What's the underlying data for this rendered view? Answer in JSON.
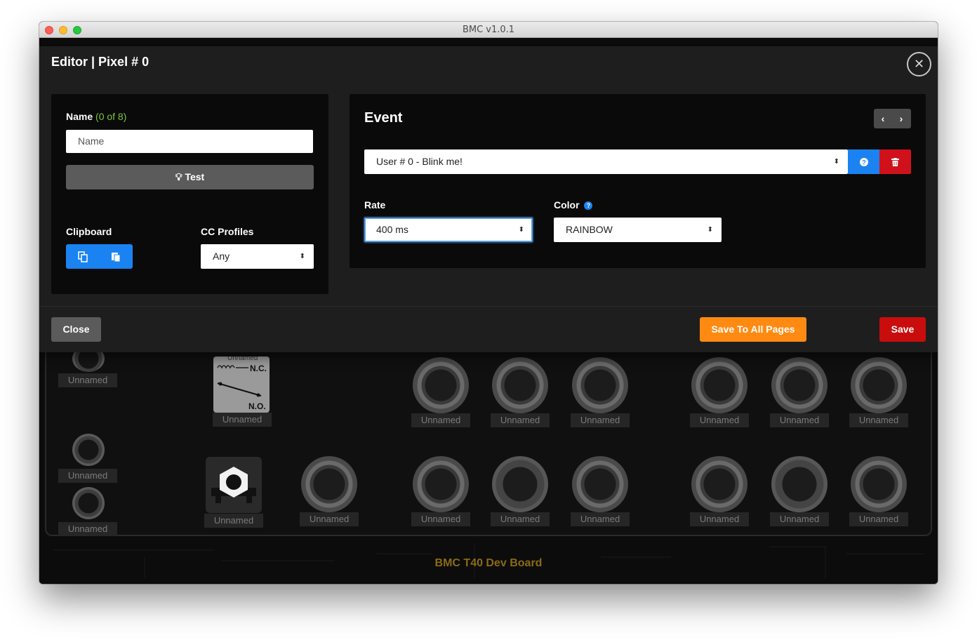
{
  "window": {
    "title": "BMC v1.0.1"
  },
  "board": {
    "title": "BMC T40 Dev Board",
    "component_label": "Unnamed",
    "relay_top_label": "Unnamed",
    "relay_nc": "N.C.",
    "relay_no": "N.O."
  },
  "modal": {
    "title": "Editor | Pixel # 0",
    "close_icon": "close-icon",
    "left": {
      "name_label": "Name",
      "name_count": "(0 of 8)",
      "name_placeholder": "Name",
      "test_label": "Test",
      "test_icon": "lightbulb-icon",
      "clipboard_label": "Clipboard",
      "cc_profiles_label": "CC Profiles",
      "cc_profiles_value": "Any"
    },
    "right": {
      "event_title": "Event",
      "event_value": "User # 0 - Blink me!",
      "rate_label": "Rate",
      "rate_value": "400 ms",
      "color_label": "Color",
      "color_value": "RAINBOW"
    },
    "footer": {
      "close_label": "Close",
      "save_all_label": "Save To All Pages",
      "save_label": "Save"
    }
  },
  "colors": {
    "accent_blue": "#1a83f1",
    "danger_red": "#d0111b",
    "warning_orange": "#ff8a12",
    "count_green": "#7cc43a"
  }
}
